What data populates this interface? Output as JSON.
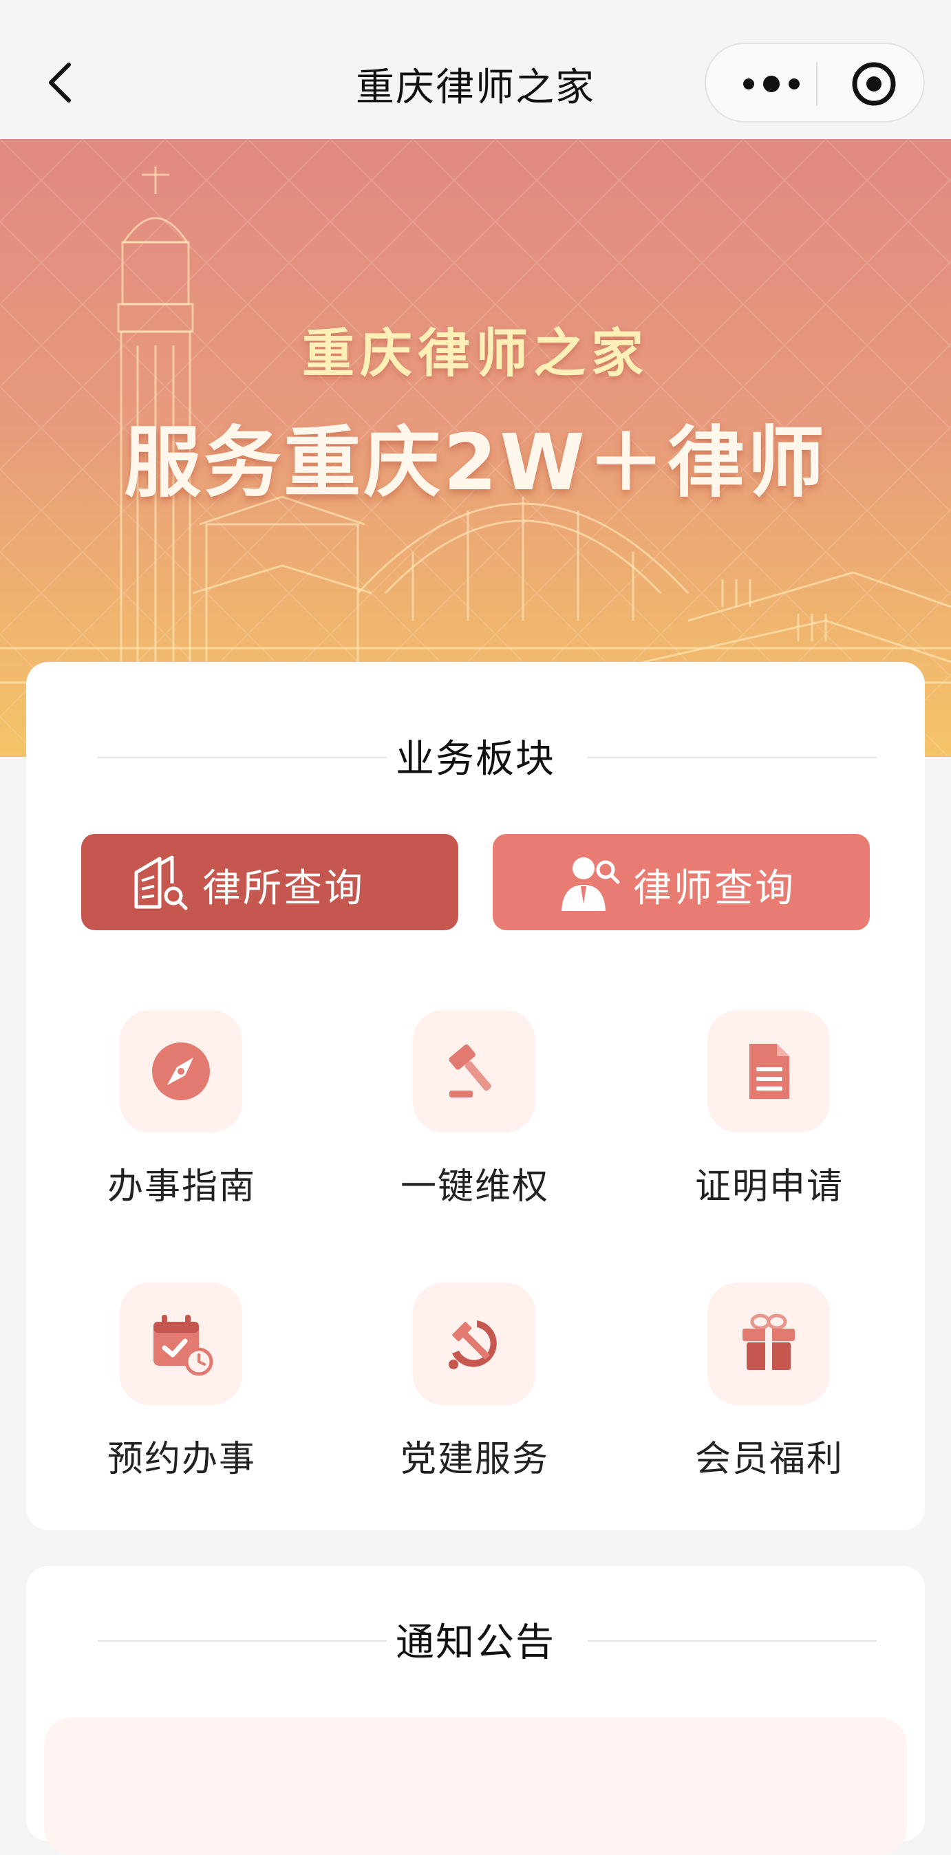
{
  "navbar": {
    "title": "重庆律师之家",
    "back_icon": "chevron-left-icon",
    "more_icon": "more-dots-icon",
    "close_icon": "target-close-icon"
  },
  "banner": {
    "title": "重庆律师之家",
    "subtitle": "服务重庆2W＋律师"
  },
  "business": {
    "heading": "业务板块",
    "buttons": [
      {
        "label": "律所查询",
        "icon": "building-search-icon",
        "color": "#c5574f"
      },
      {
        "label": "律师查询",
        "icon": "person-search-icon",
        "color": "#e97c72"
      }
    ],
    "items": [
      {
        "label": "办事指南",
        "icon": "compass-icon"
      },
      {
        "label": "一键维权",
        "icon": "gavel-icon"
      },
      {
        "label": "证明申请",
        "icon": "document-icon"
      },
      {
        "label": "预约办事",
        "icon": "calendar-clock-icon"
      },
      {
        "label": "党建服务",
        "icon": "hammer-sickle-icon"
      },
      {
        "label": "会员福利",
        "icon": "gift-icon"
      }
    ]
  },
  "notice": {
    "heading": "通知公告"
  },
  "colors": {
    "accent": "#c5574f",
    "accent_light": "#e97c72",
    "tile_bg": "#fff1ee",
    "banner_top": "#e18a82",
    "banner_bottom": "#f4c468"
  }
}
